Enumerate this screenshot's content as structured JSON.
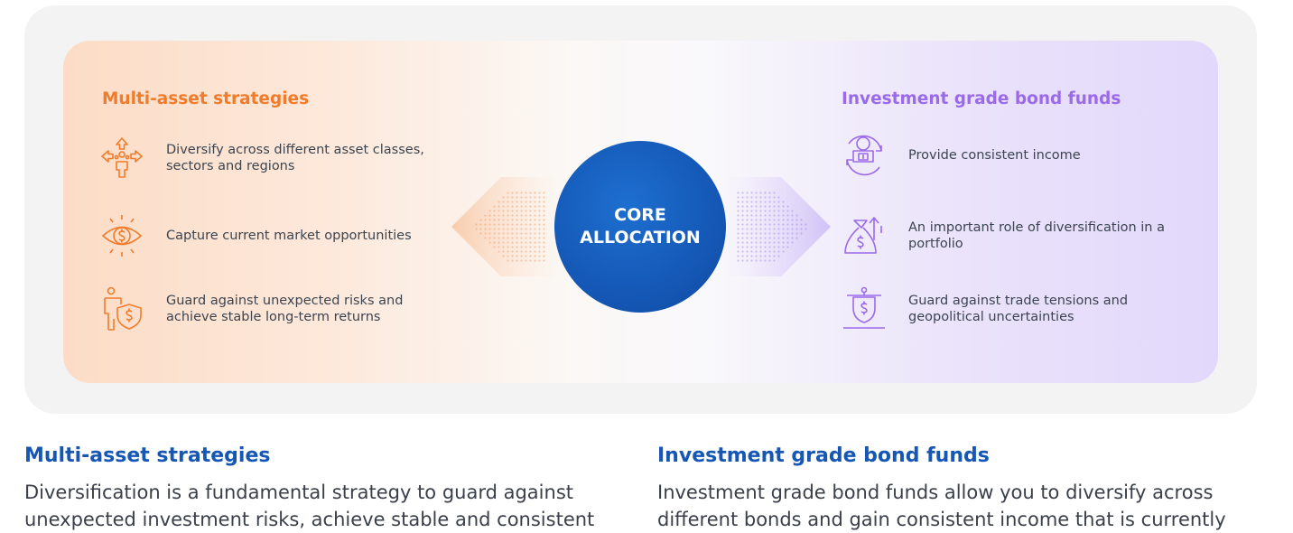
{
  "colors": {
    "orange_accent": "#f07c2b",
    "purple_accent": "#9b6ae8",
    "blue_accent": "#1657b5",
    "hub_blue": "#1558b6"
  },
  "diagram": {
    "left": {
      "title": "Multi-asset strategies",
      "items": [
        {
          "icon": "diversify-arrows-icon",
          "text": "Diversify across different asset classes, sectors and regions"
        },
        {
          "icon": "eye-dollar-icon",
          "text": "Capture current market opportunities"
        },
        {
          "icon": "person-shield-dollar-icon",
          "text": "Guard against unexpected risks and achieve stable long-term returns"
        }
      ]
    },
    "center": {
      "line1": "CORE",
      "line2": "ALLOCATION"
    },
    "right": {
      "title": "Investment grade bond funds",
      "items": [
        {
          "icon": "coin-cycle-icon",
          "text": "Provide consistent income"
        },
        {
          "icon": "money-bag-arrows-icon",
          "text": "An important role of diversification in a portfolio"
        },
        {
          "icon": "balance-scale-dollar-icon",
          "text": "Guard against trade tensions and geopolitical uncertainties"
        }
      ]
    }
  },
  "sections": {
    "left": {
      "heading": "Multi-asset strategies",
      "body": "Diversification is a fundamental strategy to guard against unexpected investment risks, achieve stable and consistent"
    },
    "right": {
      "heading": "Investment grade bond funds",
      "body": "Investment grade bond funds allow you to diversify across different bonds and gain consistent income that is currently"
    }
  }
}
